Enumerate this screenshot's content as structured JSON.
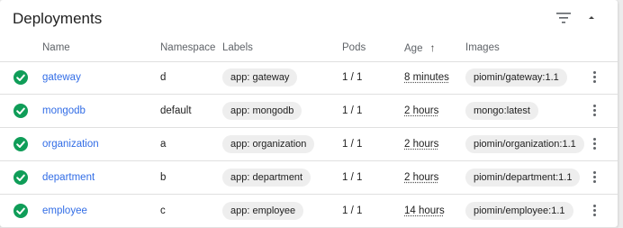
{
  "card": {
    "title": "Deployments",
    "filter_icon": "filter-icon",
    "collapse_icon": "chevron-up-icon"
  },
  "columns": {
    "name": "Name",
    "namespace": "Namespace",
    "labels": "Labels",
    "pods": "Pods",
    "age": "Age",
    "age_sort": "↑",
    "images": "Images"
  },
  "colors": {
    "status_ok": "#0f9d58",
    "link": "#326de6",
    "chip_bg": "#eeeeee"
  },
  "rows": [
    {
      "name": "gateway",
      "namespace": "d",
      "label": "app: gateway",
      "pods": "1 / 1",
      "age": "8 minutes",
      "image": "piomin/gateway:1.1"
    },
    {
      "name": "mongodb",
      "namespace": "default",
      "label": "app: mongodb",
      "pods": "1 / 1",
      "age": "2 hours",
      "image": "mongo:latest"
    },
    {
      "name": "organization",
      "namespace": "a",
      "label": "app: organization",
      "pods": "1 / 1",
      "age": "2 hours",
      "image": "piomin/organization:1.1"
    },
    {
      "name": "department",
      "namespace": "b",
      "label": "app: department",
      "pods": "1 / 1",
      "age": "2 hours",
      "image": "piomin/department:1.1"
    },
    {
      "name": "employee",
      "namespace": "c",
      "label": "app: employee",
      "pods": "1 / 1",
      "age": "14 hours",
      "image": "piomin/employee:1.1"
    }
  ]
}
